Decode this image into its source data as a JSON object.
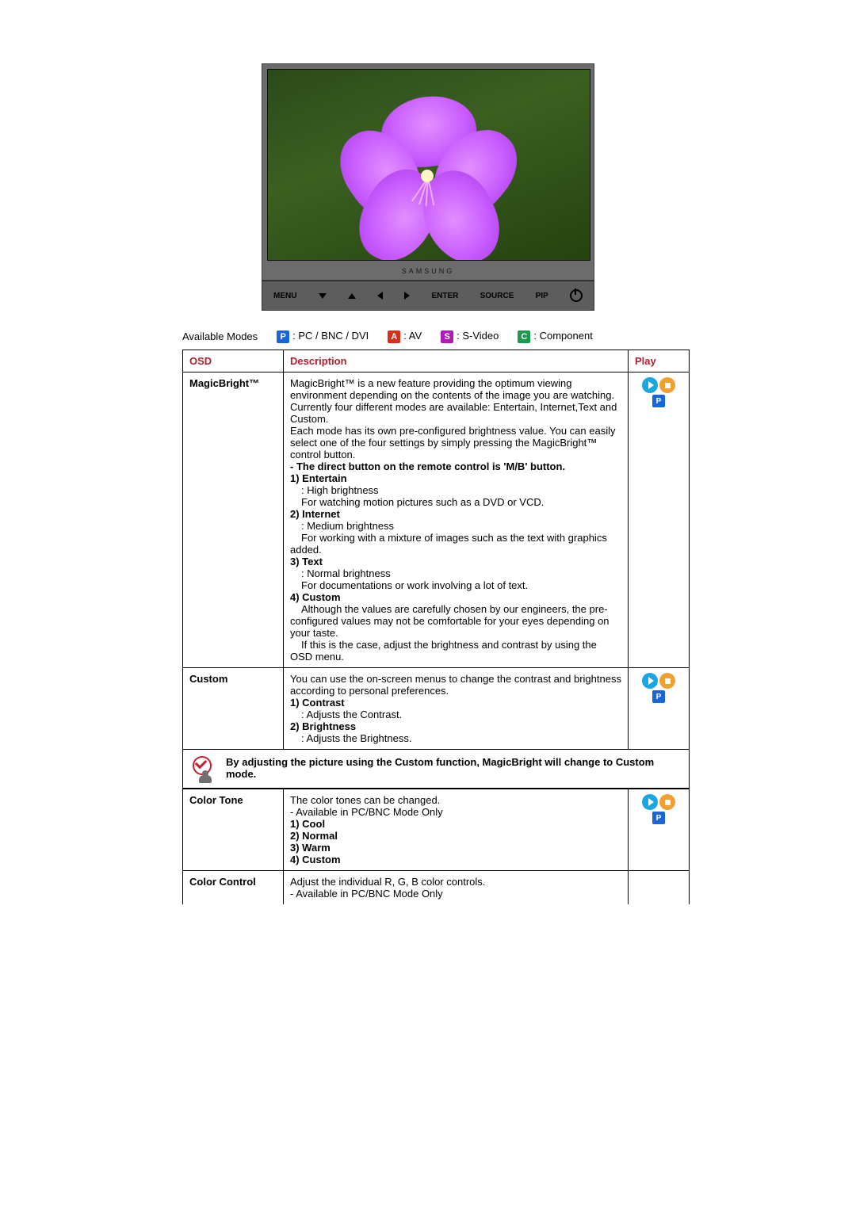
{
  "monitor": {
    "brand": "SAMSUNG",
    "buttons": {
      "menu": "MENU",
      "enter": "ENTER",
      "source": "SOURCE",
      "pip": "PIP"
    }
  },
  "modes": {
    "label": "Available Modes",
    "p": ": PC / BNC / DVI",
    "a": ": AV",
    "s": ": S-Video",
    "c": ": Component",
    "badge_p": "P",
    "badge_a": "A",
    "badge_s": "S",
    "badge_c": "C"
  },
  "headers": {
    "osd": "OSD",
    "description": "Description",
    "play": "Play"
  },
  "rows": {
    "magicbright": {
      "title": "MagicBright™",
      "intro1": "MagicBright™ is a new feature providing the optimum viewing environment depending on the contents of the image you are watching.",
      "intro2": "Currently four different modes are available: Entertain, Internet,Text and Custom.",
      "intro3": "Each mode has its own pre-configured brightness value. You can easily select one of the four settings by simply pressing the MagicBright™ control button.",
      "direct": "- The direct button on the remote control is 'M/B' button.",
      "e_title": "1) Entertain",
      "e_l1": ": High brightness",
      "e_l2": "For watching motion pictures such as a DVD or VCD.",
      "i_title": "2) Internet",
      "i_l1": ": Medium brightness",
      "i_l2": "For working with a mixture of images such as the text with graphics added.",
      "t_title": "3) Text",
      "t_l1": ": Normal brightness",
      "t_l2": "For documentations or work involving a lot of text.",
      "c_title": "4) Custom",
      "c_l1": "Although the values are carefully chosen by our engineers, the pre-configured values may not be comfortable for your eyes depending on your taste.",
      "c_l2": "If this is the case, adjust the brightness and contrast by using the OSD menu."
    },
    "custom": {
      "title": "Custom",
      "intro": "You can use the on-screen menus to change the contrast and brightness according to personal preferences.",
      "c1_title": "1) Contrast",
      "c1_desc": ": Adjusts the Contrast.",
      "c2_title": "2) Brightness",
      "c2_desc": ": Adjusts the Brightness."
    },
    "colortone": {
      "title": "Color Tone",
      "intro": "The color tones can be changed.",
      "avail": "- Available in PC/BNC Mode Only",
      "o1": "1) Cool",
      "o2": "2) Normal",
      "o3": "3) Warm",
      "o4": "4) Custom"
    },
    "colorcontrol": {
      "title": "Color Control",
      "intro": "Adjust the individual R, G, B color controls.",
      "avail": "- Available in PC/BNC Mode Only"
    }
  },
  "note": "By adjusting the picture using the Custom function, MagicBright will change to Custom mode.",
  "play_badge": "P"
}
